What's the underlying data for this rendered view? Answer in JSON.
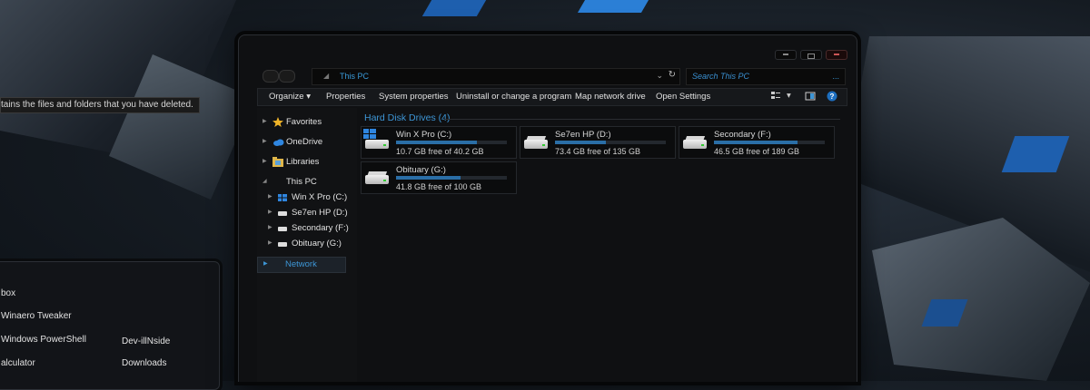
{
  "desktop": {
    "tooltip": "tains the files and folders that you have deleted.",
    "start_items": [
      {
        "label": "box"
      },
      {
        "label": "Winaero Tweaker"
      },
      {
        "label": "Windows PowerShell"
      },
      {
        "label": "alculator"
      },
      {
        "label": "Dev-illNside"
      },
      {
        "label": "Downloads"
      }
    ]
  },
  "window": {
    "address_path": "This PC",
    "search_placeholder": "Search This PC",
    "search_more": "...",
    "toolbar": {
      "organize": "Organize",
      "properties": "Properties",
      "system_properties": "System properties",
      "uninstall": "Uninstall or change a program",
      "map_drive": "Map network drive",
      "open_settings": "Open Settings"
    },
    "nav": {
      "favorites": "Favorites",
      "onedrive": "OneDrive",
      "libraries": "Libraries",
      "this_pc": "This PC",
      "drives": [
        "Win X Pro (C:)",
        "Se7en HP (D:)",
        "Secondary (F:)",
        "Obituary (G:)"
      ],
      "network": "Network"
    },
    "group_title": "Hard Disk Drives (4)",
    "drives": [
      {
        "name": "Win X Pro (C:)",
        "free": "10.7 GB free of 40.2 GB",
        "used_fraction": 0.73,
        "icon": "windows-drive-icon"
      },
      {
        "name": "Se7en HP (D:)",
        "free": "73.4 GB free of 135 GB",
        "used_fraction": 0.46,
        "icon": "hard-drive-icon"
      },
      {
        "name": "Secondary (F:)",
        "free": "46.5 GB free of 189 GB",
        "used_fraction": 0.75,
        "icon": "hard-drive-icon"
      },
      {
        "name": "Obituary (G:)",
        "free": "41.8 GB free of 100 GB",
        "used_fraction": 0.58,
        "icon": "hard-drive-icon"
      }
    ],
    "colors": {
      "accent": "#3d96d6",
      "bar_fill": "#2a6ea6"
    }
  }
}
